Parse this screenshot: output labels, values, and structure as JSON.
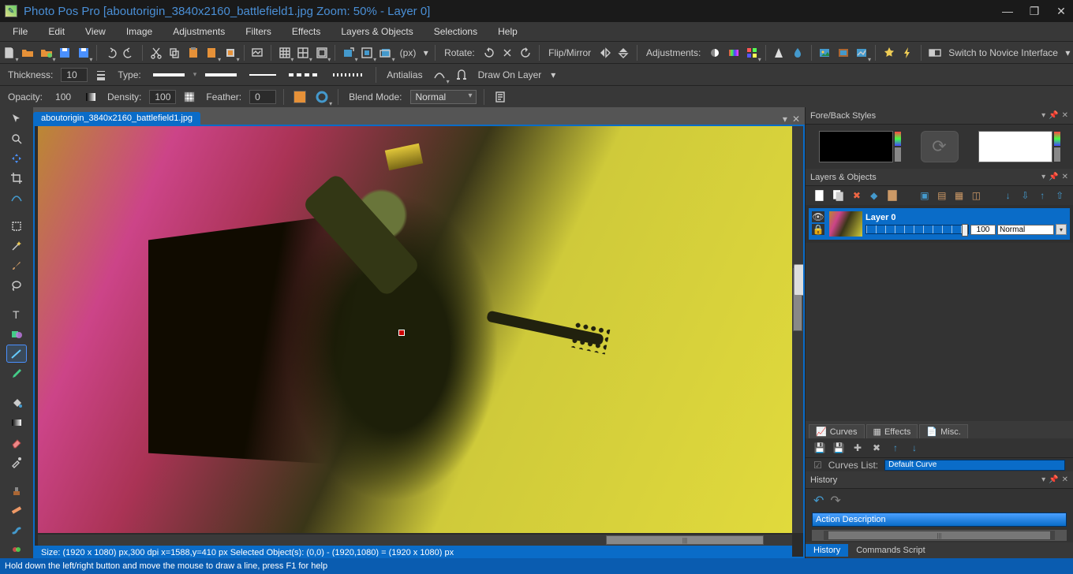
{
  "title": "Photo Pos Pro [aboutorigin_3840x2160_battlefield1.jpg Zoom: 50% - Layer 0]",
  "menu": [
    "File",
    "Edit",
    "View",
    "Image",
    "Adjustments",
    "Filters",
    "Effects",
    "Layers & Objects",
    "Selections",
    "Help"
  ],
  "toolbar1": {
    "rotate_label": "Rotate:",
    "flip_label": "Flip/Mirror",
    "adjust_label": "Adjustments:",
    "novice_label": "Switch to Novice Interface"
  },
  "opt1": {
    "thickness_label": "Thickness:",
    "thickness_val": "10",
    "type_label": "Type:",
    "antialias_label": "Antialias",
    "drawon_label": "Draw On Layer"
  },
  "opt2": {
    "opacity_label": "Opacity:",
    "opacity_val": "100",
    "density_label": "Density:",
    "density_val": "100",
    "feather_label": "Feather:",
    "feather_val": "0",
    "blend_label": "Blend Mode:",
    "blend_val": "Normal"
  },
  "doc_tab": "aboutorigin_3840x2160_battlefield1.jpg",
  "status": "Size: (1920 x 1080) px,300 dpi   x=1588,y=410 px   Selected Object(s): (0,0) - (1920,1080) = (1920 x 1080) px",
  "panels": {
    "foreback": "Fore/Back Styles",
    "layers": "Layers & Objects",
    "history": "History"
  },
  "layer": {
    "name": "Layer 0",
    "opacity": "100",
    "mode": "Normal"
  },
  "subtabs": [
    "Curves",
    "Effects",
    "Misc."
  ],
  "curves_label": "Curves List:",
  "curves_name": "Default Curve",
  "hist_undo": "↶",
  "hist_redo": "↷",
  "hist_desc": "Action Description",
  "bottom_tabs": [
    "History",
    "Commands Script"
  ],
  "footer": "Hold down the left/right button and move the mouse to draw a line, press F1 for help",
  "px_label": "(px)"
}
